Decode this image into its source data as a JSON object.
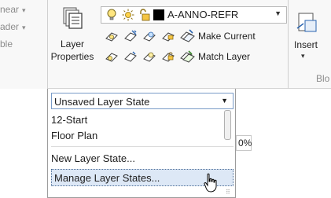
{
  "left_panel": {
    "items": [
      {
        "label": "near",
        "chevron": "▾"
      },
      {
        "label": "ader",
        "chevron": "▾"
      },
      {
        "label": "ble"
      }
    ]
  },
  "layer_properties": {
    "line1": "Layer",
    "line2": "Properties",
    "icon": "layer-stack-icon"
  },
  "current_layer": {
    "name": "A-ANNO-REFR",
    "state_icons": [
      "lightbulb-icon",
      "sun-icon",
      "lock-open-icon"
    ],
    "color": "#000000"
  },
  "tools": {
    "make_current": "Make Current",
    "match_layer": "Match Layer"
  },
  "insert": {
    "label": "Insert",
    "icon": "insert-block-icon",
    "chevron": "▾"
  },
  "block_panel_label": "Blo",
  "layer_state_dropdown": {
    "current": "Unsaved Layer State",
    "items": [
      "12-Start",
      "Floor Plan"
    ],
    "new_state": "New Layer State...",
    "manage": "Manage Layer States...",
    "partial_value": "0%"
  }
}
